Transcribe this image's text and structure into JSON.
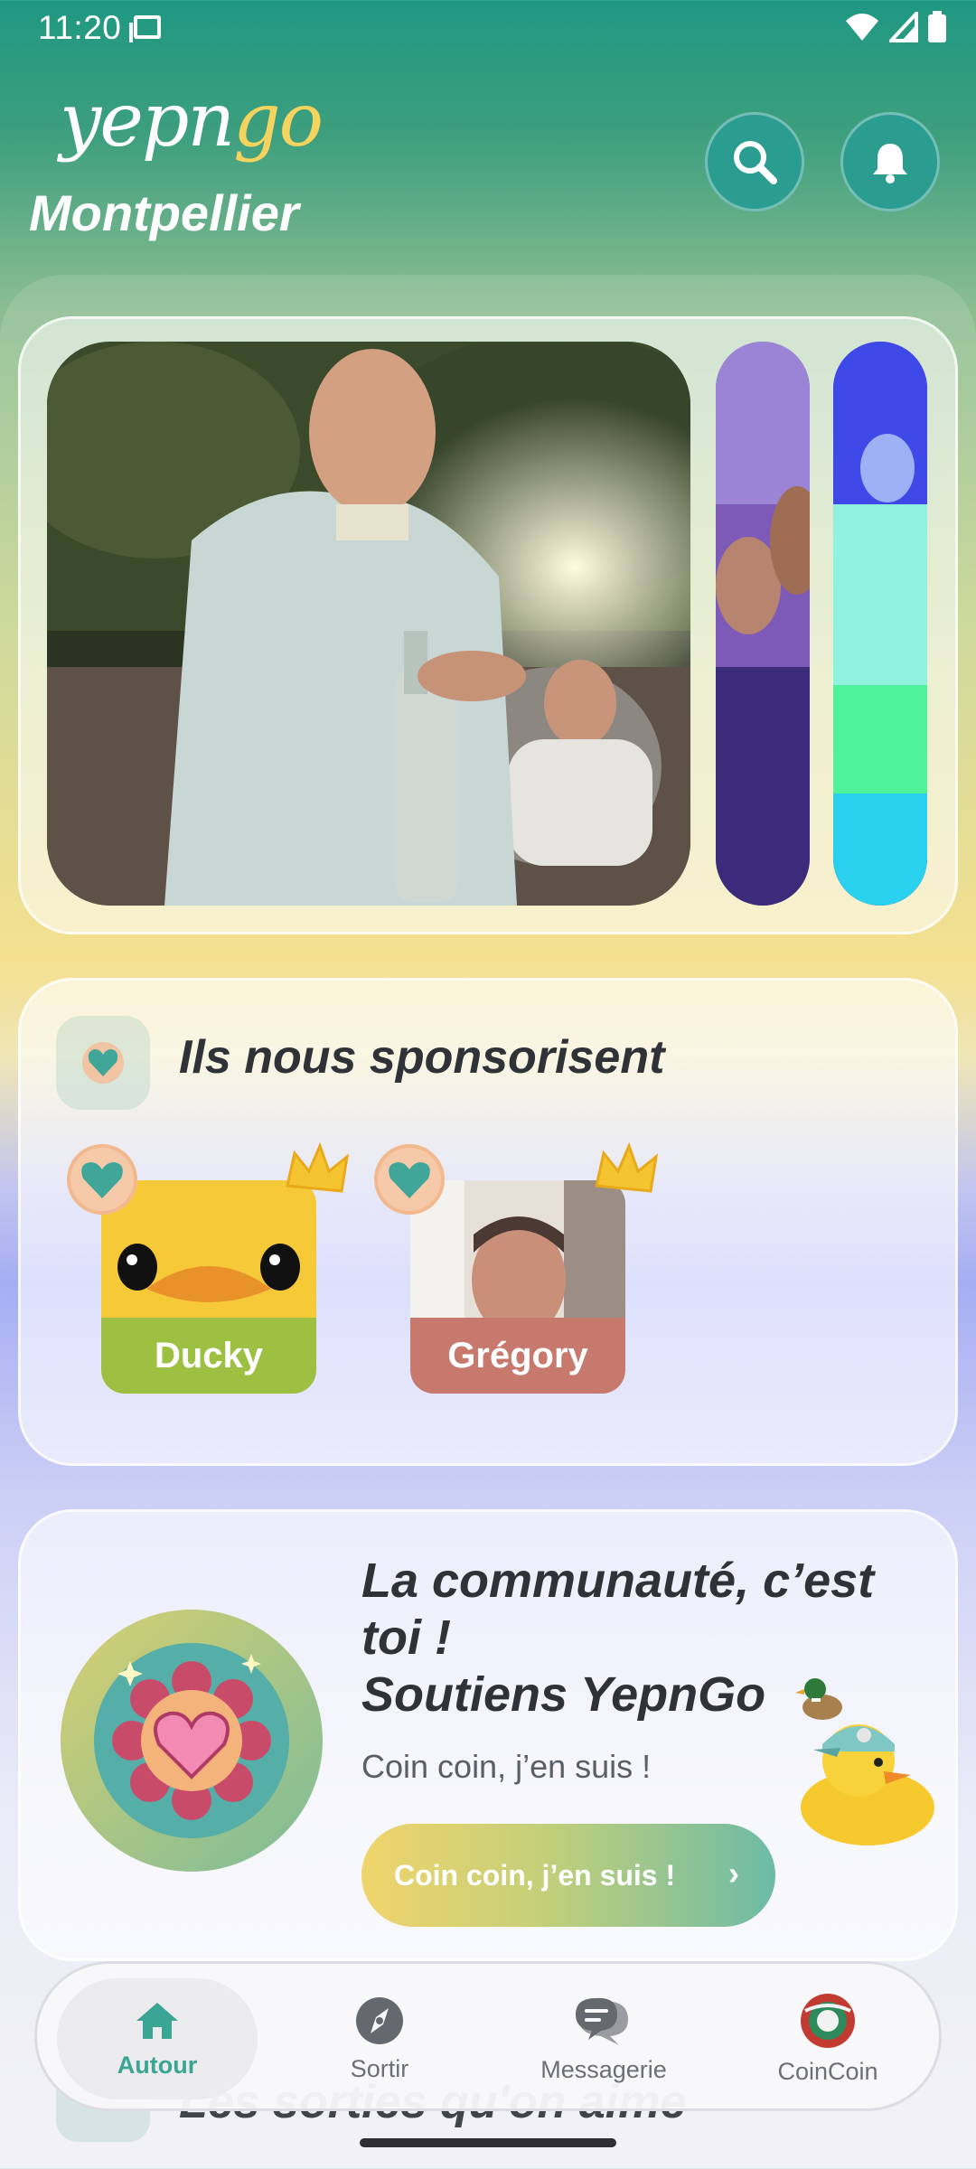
{
  "status_bar": {
    "time": "11:20"
  },
  "header": {
    "logo_main": "yepn",
    "logo_accent": "go",
    "city": "Montpellier"
  },
  "sponsors": {
    "title": "Ils nous sponsorisent",
    "items": [
      {
        "name": "Ducky"
      },
      {
        "name": "Grégory"
      }
    ]
  },
  "community": {
    "title_line1": "La communauté, c’est",
    "title_line2": "toi !",
    "title_line3": "Soutiens YepnGo",
    "subtitle": "Coin coin, j’en suis !",
    "cta_label": "Coin coin, j’en suis !"
  },
  "next_section_peek": "Les sorties qu'on aime",
  "nav": {
    "items": [
      {
        "label": "Autour"
      },
      {
        "label": "Sortir"
      },
      {
        "label": "Messagerie"
      },
      {
        "label": "CoinCoin"
      }
    ]
  },
  "colors": {
    "accent": "#3aa593",
    "header": "#1f9882"
  }
}
